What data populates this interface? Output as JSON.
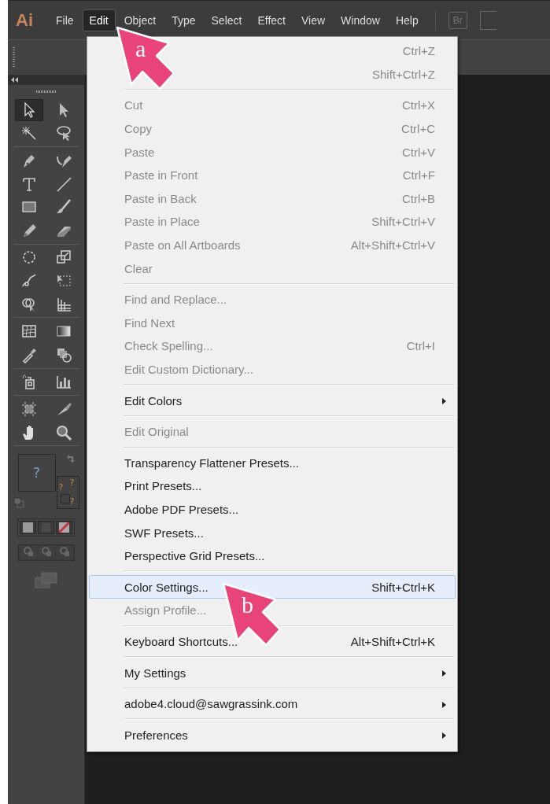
{
  "menubar": {
    "logo": "Ai",
    "items": [
      {
        "label": "File",
        "selected": false
      },
      {
        "label": "Edit",
        "selected": true
      },
      {
        "label": "Object",
        "selected": false
      },
      {
        "label": "Type",
        "selected": false
      },
      {
        "label": "Select",
        "selected": false
      },
      {
        "label": "Effect",
        "selected": false
      },
      {
        "label": "View",
        "selected": false
      },
      {
        "label": "Window",
        "selected": false
      },
      {
        "label": "Help",
        "selected": false
      }
    ],
    "bridge_button": "Br"
  },
  "toolbox": {
    "tools": [
      {
        "selected": true
      },
      {
        "selected": false
      },
      {
        "selected": false
      },
      {
        "selected": false
      },
      {
        "selected": false
      },
      {
        "selected": false
      },
      {
        "selected": false
      },
      {
        "selected": false
      },
      {
        "selected": false
      },
      {
        "selected": false
      },
      {
        "selected": false
      },
      {
        "selected": false
      },
      {
        "selected": false
      },
      {
        "selected": false
      },
      {
        "selected": false
      },
      {
        "selected": false
      },
      {
        "selected": false
      },
      {
        "selected": false
      },
      {
        "selected": false
      },
      {
        "selected": false
      },
      {
        "selected": false
      },
      {
        "selected": false
      },
      {
        "selected": false
      },
      {
        "selected": false
      },
      {
        "selected": false
      },
      {
        "selected": false
      },
      {
        "selected": false
      },
      {
        "selected": false
      }
    ],
    "fill_mark": "?",
    "stroke_marks": [
      "?",
      "?",
      "?"
    ]
  },
  "edit_menu": {
    "groups": [
      [
        {
          "shortcut": "Ctrl+Z",
          "enabled": false,
          "submenu": false,
          "highlighted": false
        },
        {
          "shortcut": "Shift+Ctrl+Z",
          "enabled": false,
          "submenu": false,
          "highlighted": false
        }
      ],
      [
        {
          "label": "Cut",
          "shortcut": "Ctrl+X",
          "enabled": false,
          "submenu": false,
          "highlighted": false
        },
        {
          "label": "Copy",
          "shortcut": "Ctrl+C",
          "enabled": false,
          "submenu": false,
          "highlighted": false
        },
        {
          "label": "Paste",
          "shortcut": "Ctrl+V",
          "enabled": false,
          "submenu": false,
          "highlighted": false
        },
        {
          "label": "Paste in Front",
          "shortcut": "Ctrl+F",
          "enabled": false,
          "submenu": false,
          "highlighted": false
        },
        {
          "label": "Paste in Back",
          "shortcut": "Ctrl+B",
          "enabled": false,
          "submenu": false,
          "highlighted": false
        },
        {
          "label": "Paste in Place",
          "shortcut": "Shift+Ctrl+V",
          "enabled": false,
          "submenu": false,
          "highlighted": false
        },
        {
          "label": "Paste on All Artboards",
          "shortcut": "Alt+Shift+Ctrl+V",
          "enabled": false,
          "submenu": false,
          "highlighted": false
        },
        {
          "label": "Clear",
          "enabled": false,
          "submenu": false,
          "highlighted": false
        }
      ],
      [
        {
          "label": "Find and Replace...",
          "enabled": false,
          "submenu": false,
          "highlighted": false
        },
        {
          "label": "Find Next",
          "enabled": false,
          "submenu": false,
          "highlighted": false
        },
        {
          "label": "Check Spelling...",
          "shortcut": "Ctrl+I",
          "enabled": false,
          "submenu": false,
          "highlighted": false
        },
        {
          "label": "Edit Custom Dictionary...",
          "enabled": false,
          "submenu": false,
          "highlighted": false
        }
      ],
      [
        {
          "label": "Edit Colors",
          "enabled": true,
          "submenu": true,
          "highlighted": false
        }
      ],
      [
        {
          "label": "Edit Original",
          "enabled": false,
          "submenu": false,
          "highlighted": false
        }
      ],
      [
        {
          "label": "Transparency Flattener Presets...",
          "enabled": true,
          "submenu": false,
          "highlighted": false
        },
        {
          "label": "Print Presets...",
          "enabled": true,
          "submenu": false,
          "highlighted": false
        },
        {
          "label": "Adobe PDF Presets...",
          "enabled": true,
          "submenu": false,
          "highlighted": false
        },
        {
          "label": "SWF Presets...",
          "enabled": true,
          "submenu": false,
          "highlighted": false
        },
        {
          "label": "Perspective Grid Presets...",
          "enabled": true,
          "submenu": false,
          "highlighted": false
        }
      ],
      [
        {
          "label": "Color Settings...",
          "shortcut": "Shift+Ctrl+K",
          "enabled": true,
          "submenu": false,
          "highlighted": true
        },
        {
          "label": "Assign Profile...",
          "enabled": false,
          "submenu": false,
          "highlighted": false
        }
      ],
      [
        {
          "label": "Keyboard Shortcuts...",
          "shortcut": "Alt+Shift+Ctrl+K",
          "enabled": true,
          "submenu": false,
          "highlighted": false
        }
      ],
      [
        {
          "label": "My Settings",
          "enabled": true,
          "submenu": true,
          "highlighted": false
        }
      ],
      [
        {
          "label": "adobe4.cloud@sawgrassink.com",
          "enabled": true,
          "submenu": true,
          "highlighted": false
        }
      ],
      [
        {
          "label": "Preferences",
          "enabled": true,
          "submenu": true,
          "highlighted": false
        }
      ]
    ]
  },
  "callouts": [
    {
      "label": "a"
    },
    {
      "label": "b"
    }
  ]
}
